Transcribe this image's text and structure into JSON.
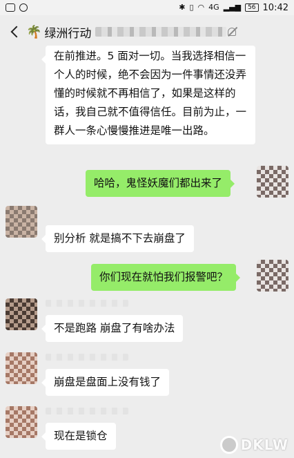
{
  "status_bar": {
    "battery": "56",
    "signal_label": "4G",
    "time": "10:42"
  },
  "header": {
    "title": "绿洲行动"
  },
  "messages": [
    {
      "side": "left",
      "text": "在前推进。5 面对一切。当我选择相信一个人的时候，绝不会因为一件事情还没弄懂的时候就不再相信了，如果是这样的话，我自己就不值得信任。目前为止，一群人一条心慢慢推进是唯一出路。"
    },
    {
      "side": "right",
      "text": "哈哈，鬼怪妖魔们都出来了"
    },
    {
      "side": "left",
      "text": "别分析 就是搞不下去崩盘了"
    },
    {
      "side": "right",
      "text": "你们现在就怕我们报警吧？"
    },
    {
      "side": "left",
      "text": "不是跑路 崩盘了有啥办法"
    },
    {
      "side": "left",
      "text": "崩盘是盘面上没有钱了"
    },
    {
      "side": "left",
      "text": "现在是锁仓"
    }
  ],
  "watermark": {
    "text": "DKLW"
  },
  "colors": {
    "background": "#ededed",
    "bubble_self": "#95ec69",
    "bubble_other": "#ffffff"
  },
  "icons": [
    "back-icon",
    "palm-tree-icon",
    "mute-icon"
  ]
}
